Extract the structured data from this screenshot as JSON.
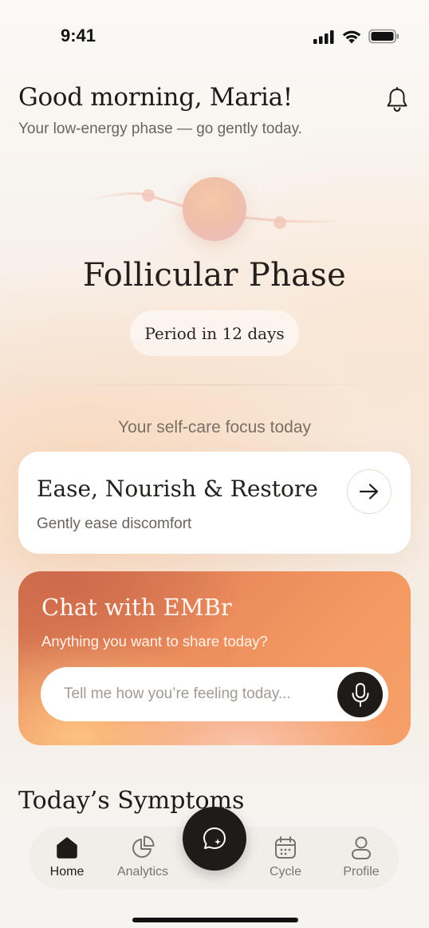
{
  "status_bar": {
    "time": "9:41"
  },
  "header": {
    "greeting": "Good morning, Maria!",
    "subtitle": "Your low-energy phase — go gently today."
  },
  "phase": {
    "title": "Follicular Phase",
    "period_pill": "Period in 12 days"
  },
  "focus": {
    "label": "Your self-care focus today",
    "card_title": "Ease, Nourish & Restore",
    "card_subtitle": "Gently ease discomfort"
  },
  "chat": {
    "title": "Chat with EMBr",
    "subtitle": "Anything you want to share today?",
    "placeholder": "Tell me how you’re feeling today..."
  },
  "symptoms": {
    "title": "Today’s Symptoms"
  },
  "nav": {
    "items": [
      {
        "label": "Home",
        "icon": "home-icon",
        "active": true
      },
      {
        "label": "Analytics",
        "icon": "analytics-icon",
        "active": false
      },
      {
        "label": "Cycle",
        "icon": "calendar-icon",
        "active": false
      },
      {
        "label": "Profile",
        "icon": "profile-icon",
        "active": false
      }
    ],
    "fab_icon": "chat-sparkle-icon"
  },
  "colors": {
    "accent_orange": "#ec8d5d",
    "dark": "#1f1b19",
    "muted_text": "#6b645e"
  }
}
